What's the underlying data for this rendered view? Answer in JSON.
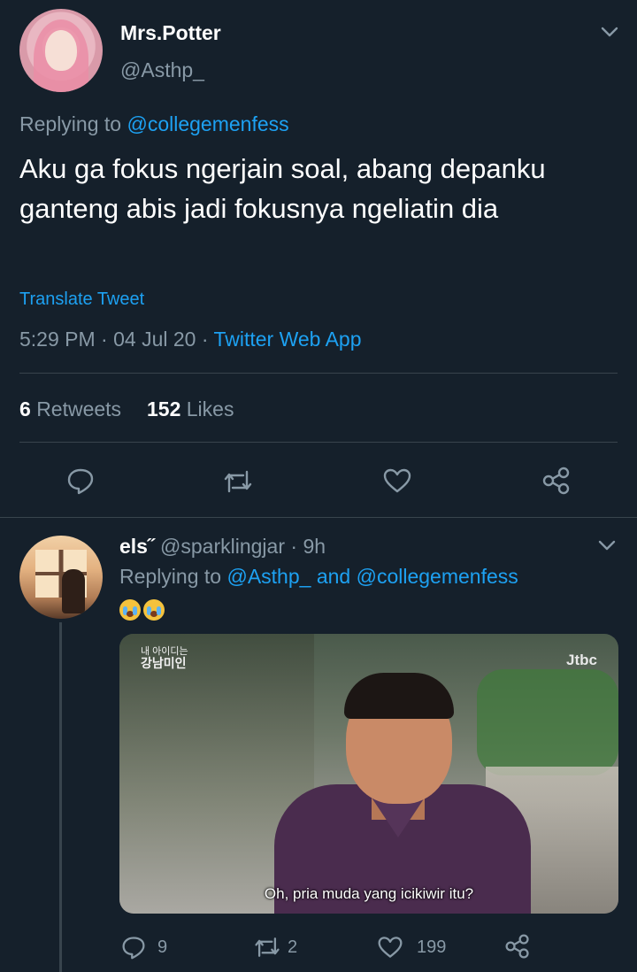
{
  "tweet": {
    "display_name": "Mrs.Potter",
    "handle": "@Asthp_",
    "replying_prefix": "Replying to",
    "replying_to": "@collegemenfess",
    "text": "Aku ga fokus ngerjain soal, abang depanku ganteng abis jadi fokusnya ngeliatin dia",
    "translate_label": "Translate Tweet",
    "timestamp": "5:29 PM · 04 Jul 20 · ",
    "source": "Twitter Web App",
    "retweets_count": "6",
    "retweets_label": "Retweets",
    "likes_count": "152",
    "likes_label": "Likes"
  },
  "reply": {
    "display_name": "els˝",
    "handle": "@sparklingjar",
    "time": "· 9h",
    "replying_prefix": "Replying to",
    "replying_to_1": "@Asthp_",
    "replying_and": "and",
    "replying_to_2": "@collegemenfess",
    "video": {
      "show_title_top": "내 아이디는",
      "show_title": "강남미인",
      "channel": "JTBC",
      "channel_logo": "Jtbc",
      "subtitle": "Oh, pria muda yang icikiwir itu?"
    },
    "reply_count": "9",
    "retweet_count": "2",
    "like_count": "199"
  },
  "colors": {
    "background": "#15202b",
    "accent": "#1da1f2",
    "muted": "#8899a6",
    "divider": "#38444d"
  }
}
